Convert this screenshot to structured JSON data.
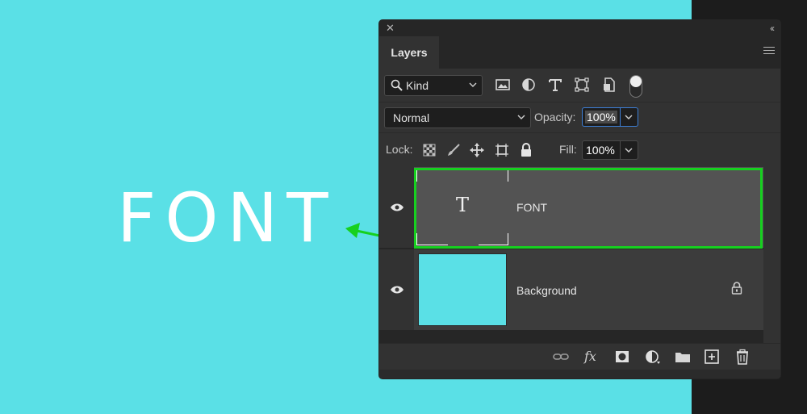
{
  "canvas": {
    "text": "FONT",
    "background_color": "#5ae0e6",
    "highlight_color": "#16d11f"
  },
  "panel": {
    "title_tab": "Layers",
    "filter": {
      "kind_label": "Kind"
    },
    "blend_mode": "Normal",
    "opacity_label": "Opacity:",
    "opacity_value": "100%",
    "lock_label": "Lock:",
    "fill_label": "Fill:",
    "fill_value": "100%",
    "layers": [
      {
        "name": "FONT",
        "type": "text",
        "thumb_glyph": "T",
        "visible": true,
        "selected": true
      },
      {
        "name": "Background",
        "type": "image",
        "visible": true,
        "locked": true,
        "thumb_color": "#5ae0e6"
      }
    ],
    "footer_fx": "fx"
  }
}
